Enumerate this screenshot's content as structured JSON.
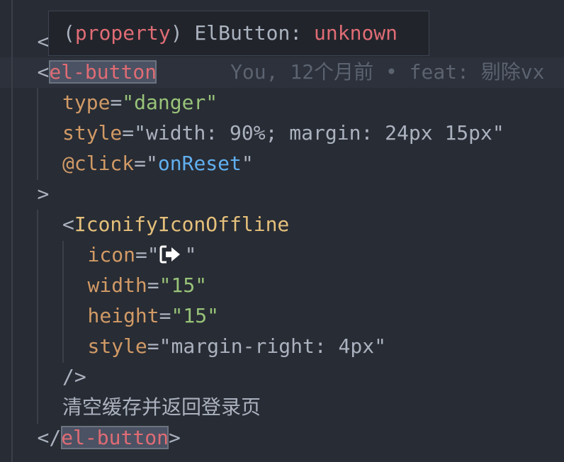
{
  "editor": {
    "lines": [
      {
        "indent": 1,
        "tokens": [
          {
            "text": "<",
            "kind": "punct"
          }
        ]
      },
      {
        "indent": 1,
        "current": true,
        "tokens": [
          {
            "text": "<",
            "kind": "punct"
          },
          {
            "text": "el-button",
            "kind": "tag",
            "highlight": true
          },
          {
            "text": "You, 12个月前 • feat: 剔除vx",
            "kind": "blame"
          }
        ]
      },
      {
        "indent": 2,
        "tokens": [
          {
            "text": "type",
            "kind": "attr"
          },
          {
            "text": "=",
            "kind": "punct"
          },
          {
            "text": "\"danger\"",
            "kind": "str"
          }
        ]
      },
      {
        "indent": 2,
        "tokens": [
          {
            "text": "style",
            "kind": "attr"
          },
          {
            "text": "=",
            "kind": "punct"
          },
          {
            "text": "\"width: 90%; margin: 24px 15px\"",
            "kind": "text"
          }
        ]
      },
      {
        "indent": 2,
        "tokens": [
          {
            "text": "@click",
            "kind": "attr"
          },
          {
            "text": "=",
            "kind": "punct"
          },
          {
            "text": "\"",
            "kind": "punct"
          },
          {
            "text": "onReset",
            "kind": "fn"
          },
          {
            "text": "\"",
            "kind": "punct"
          }
        ]
      },
      {
        "indent": 1,
        "tokens": [
          {
            "text": ">",
            "kind": "punct"
          }
        ]
      },
      {
        "indent": 2,
        "tokens": [
          {
            "text": "<",
            "kind": "punct"
          },
          {
            "text": "IconifyIconOffline",
            "kind": "comp"
          }
        ]
      },
      {
        "indent": 3,
        "tokens": [
          {
            "text": "icon",
            "kind": "attr"
          },
          {
            "text": "=\"",
            "kind": "punct"
          },
          {
            "text": "",
            "kind": "icon",
            "icon": "sign-in-icon"
          },
          {
            "text": "\"",
            "kind": "punct"
          }
        ]
      },
      {
        "indent": 3,
        "tokens": [
          {
            "text": "width",
            "kind": "attr"
          },
          {
            "text": "=",
            "kind": "punct"
          },
          {
            "text": "\"15\"",
            "kind": "str"
          }
        ]
      },
      {
        "indent": 3,
        "tokens": [
          {
            "text": "height",
            "kind": "attr"
          },
          {
            "text": "=",
            "kind": "punct"
          },
          {
            "text": "\"15\"",
            "kind": "str"
          }
        ]
      },
      {
        "indent": 3,
        "tokens": [
          {
            "text": "style",
            "kind": "attr"
          },
          {
            "text": "=",
            "kind": "punct"
          },
          {
            "text": "\"margin-right: 4px\"",
            "kind": "text"
          }
        ]
      },
      {
        "indent": 2,
        "tokens": [
          {
            "text": "/>",
            "kind": "punct"
          }
        ]
      },
      {
        "indent": 2,
        "tokens": [
          {
            "text": "清空缓存并返回登录页",
            "kind": "text"
          }
        ]
      },
      {
        "indent": 1,
        "tokens": [
          {
            "text": "</",
            "kind": "punct"
          },
          {
            "text": "el-button",
            "kind": "tag",
            "highlight": true
          },
          {
            "text": ">",
            "kind": "punct"
          }
        ]
      }
    ]
  },
  "tooltip": {
    "open_paren": "(",
    "keyword": "property",
    "close_paren": ")",
    "name": " ElButton: ",
    "type": "unknown"
  },
  "colors": {
    "background": "#282c34",
    "tag": "#e06c75",
    "attribute": "#d19a66",
    "string": "#98c379",
    "function": "#61afef",
    "component": "#e5c07b"
  }
}
